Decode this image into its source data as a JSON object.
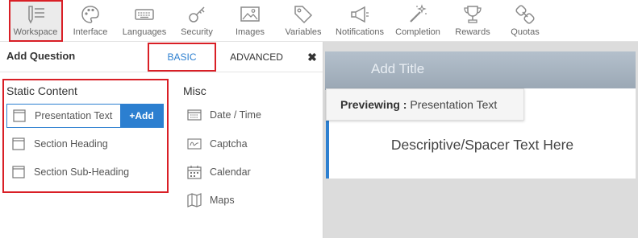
{
  "toolbar": {
    "items": [
      {
        "label": "Workspace",
        "icon": "workspace-icon"
      },
      {
        "label": "Interface",
        "icon": "palette-icon"
      },
      {
        "label": "Languages",
        "icon": "keyboard-icon"
      },
      {
        "label": "Security",
        "icon": "key-icon"
      },
      {
        "label": "Images",
        "icon": "image-icon"
      },
      {
        "label": "Variables",
        "icon": "tag-icon"
      },
      {
        "label": "Notifications",
        "icon": "megaphone-icon"
      },
      {
        "label": "Completion",
        "icon": "magic-wand-icon"
      },
      {
        "label": "Rewards",
        "icon": "trophy-icon"
      },
      {
        "label": "Quotas",
        "icon": "chain-icon"
      }
    ],
    "active": "Workspace"
  },
  "panel": {
    "title": "Add Question",
    "tabs": {
      "basic": "BASIC",
      "advanced": "ADVANCED"
    },
    "close": "✖"
  },
  "static_content": {
    "heading": "Static Content",
    "items": [
      {
        "label": "Presentation Text",
        "icon": "presentation-text-icon"
      },
      {
        "label": "Section Heading",
        "icon": "section-heading-icon"
      },
      {
        "label": "Section Sub-Heading",
        "icon": "section-subheading-icon"
      }
    ],
    "add_label": "+Add"
  },
  "misc": {
    "heading": "Misc",
    "items": [
      {
        "label": "Date / Time",
        "icon": "date-time-icon"
      },
      {
        "label": "Captcha",
        "icon": "captcha-icon"
      },
      {
        "label": "Calendar",
        "icon": "calendar-icon"
      },
      {
        "label": "Maps",
        "icon": "map-icon"
      }
    ]
  },
  "preview": {
    "title_placeholder": "Add Title",
    "previewing_prefix": "Previewing :",
    "previewing_value": "Presentation Text",
    "body_text": "Descriptive/Spacer Text Here"
  },
  "colors": {
    "accent": "#2c7fd0",
    "highlight": "#d91f26"
  }
}
